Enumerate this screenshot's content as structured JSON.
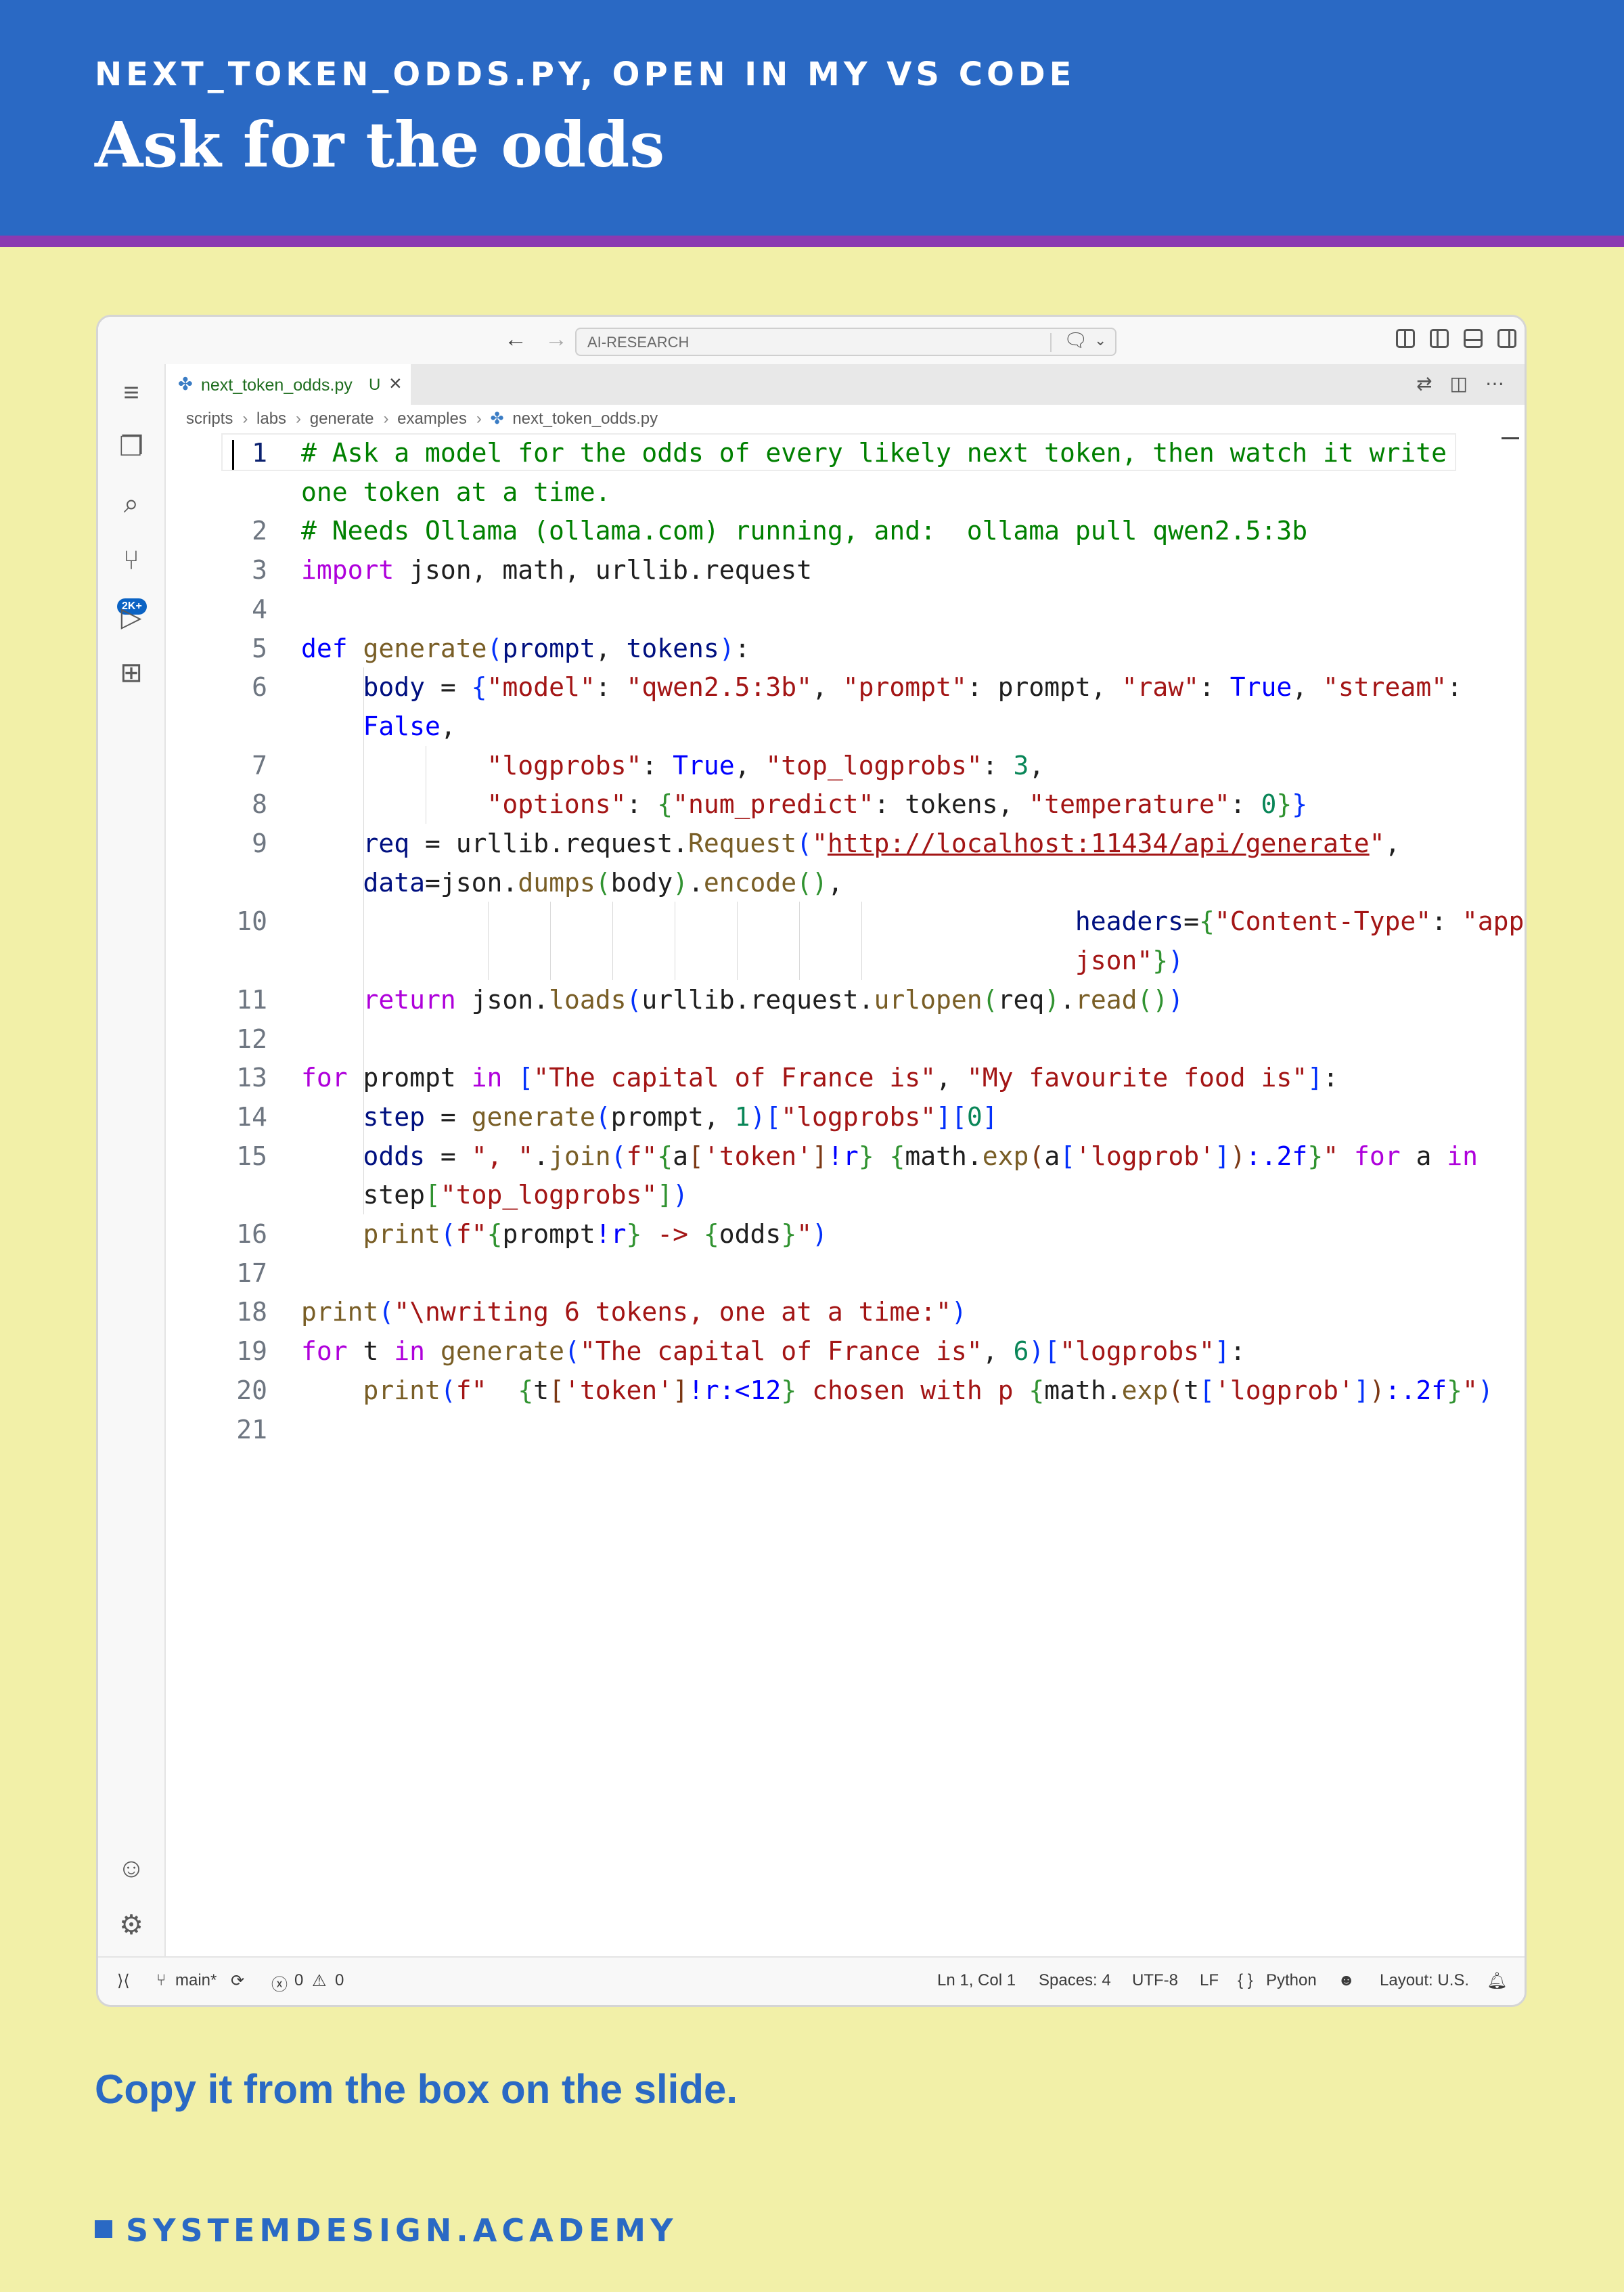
{
  "slide": {
    "kicker": "NEXT_TOKEN_ODDS.PY, OPEN IN MY VS CODE",
    "title": "Ask for the odds",
    "caption": "Copy it from the box on the slide.",
    "brand": "SYSTEMDESIGN.ACADEMY"
  },
  "titlebar": {
    "command_center": "AI-RESEARCH"
  },
  "activity_bar": {
    "scm_badge": "2K+"
  },
  "tab": {
    "filename": "next_token_odds.py",
    "status": "U"
  },
  "breadcrumbs": [
    "scripts",
    "labs",
    "generate",
    "examples",
    "next_token_odds.py"
  ],
  "editor": {
    "line_numbers": [
      "1",
      "2",
      "3",
      "4",
      "5",
      "6",
      "7",
      "8",
      "9",
      "10",
      "11",
      "12",
      "13",
      "14",
      "15",
      "16",
      "17",
      "18",
      "19",
      "20",
      "21"
    ]
  },
  "statusbar": {
    "branch": "main*",
    "errors": "0",
    "warnings": "0",
    "position": "Ln 1, Col 1",
    "spaces": "Spaces: 4",
    "encoding": "UTF-8",
    "eol": "LF",
    "language": "Python",
    "layout": "Layout: U.S."
  },
  "code_lines": [
    [
      [
        "c-com",
        "# Ask a model for the odds of every likely next token, then watch it write"
      ]
    ],
    [
      [
        "c-com",
        "one token at a time."
      ]
    ],
    [
      [
        "c-com",
        "# Needs Ollama (ollama.com) running, and:  ollama pull qwen2.5:3b"
      ]
    ],
    [
      [
        "c-kw",
        "import"
      ],
      [
        "c-id",
        " json, math, urllib.request"
      ]
    ],
    [],
    [
      [
        "c-def",
        "def"
      ],
      [
        "c-id",
        " "
      ],
      [
        "c-fn",
        "generate"
      ],
      [
        "c-b1",
        "("
      ],
      [
        "c-var",
        "prompt"
      ],
      [
        "c-id",
        ", "
      ],
      [
        "c-var",
        "tokens"
      ],
      [
        "c-b1",
        ")"
      ],
      [
        "c-id",
        ":"
      ]
    ],
    [
      [
        "c-id",
        "    "
      ],
      [
        "c-var",
        "body"
      ],
      [
        "c-id",
        " = "
      ],
      [
        "c-b1",
        "{"
      ],
      [
        "c-str",
        "\"model\""
      ],
      [
        "c-id",
        ": "
      ],
      [
        "c-str",
        "\"qwen2.5:3b\""
      ],
      [
        "c-id",
        ", "
      ],
      [
        "c-str",
        "\"prompt\""
      ],
      [
        "c-id",
        ": prompt, "
      ],
      [
        "c-str",
        "\"raw\""
      ],
      [
        "c-id",
        ": "
      ],
      [
        "c-def",
        "True"
      ],
      [
        "c-id",
        ", "
      ],
      [
        "c-str",
        "\"stream\""
      ],
      [
        "c-id",
        ":"
      ]
    ],
    [
      [
        "c-id",
        "    "
      ],
      [
        "c-def",
        "False"
      ],
      [
        "c-id",
        ","
      ]
    ],
    [
      [
        "c-id",
        "            "
      ],
      [
        "c-str",
        "\"logprobs\""
      ],
      [
        "c-id",
        ": "
      ],
      [
        "c-def",
        "True"
      ],
      [
        "c-id",
        ", "
      ],
      [
        "c-str",
        "\"top_logprobs\""
      ],
      [
        "c-id",
        ": "
      ],
      [
        "c-num",
        "3"
      ],
      [
        "c-id",
        ","
      ]
    ],
    [
      [
        "c-id",
        "            "
      ],
      [
        "c-str",
        "\"options\""
      ],
      [
        "c-id",
        ": "
      ],
      [
        "c-b2",
        "{"
      ],
      [
        "c-str",
        "\"num_predict\""
      ],
      [
        "c-id",
        ": tokens, "
      ],
      [
        "c-str",
        "\"temperature\""
      ],
      [
        "c-id",
        ": "
      ],
      [
        "c-num",
        "0"
      ],
      [
        "c-b2",
        "}"
      ],
      [
        "c-b1",
        "}"
      ]
    ],
    [
      [
        "c-id",
        "    "
      ],
      [
        "c-var",
        "req"
      ],
      [
        "c-id",
        " = urllib.request."
      ],
      [
        "c-fn",
        "Request"
      ],
      [
        "c-b1",
        "("
      ],
      [
        "c-str",
        "\""
      ],
      [
        "c-url",
        "http://localhost:11434/api/generate"
      ],
      [
        "c-str",
        "\""
      ],
      [
        "c-id",
        ","
      ]
    ],
    [
      [
        "c-id",
        "    "
      ],
      [
        "c-var",
        "data"
      ],
      [
        "c-id",
        "=json."
      ],
      [
        "c-fn",
        "dumps"
      ],
      [
        "c-b2",
        "("
      ],
      [
        "c-id",
        "body"
      ],
      [
        "c-b2",
        ")"
      ],
      [
        "c-id",
        "."
      ],
      [
        "c-fn",
        "encode"
      ],
      [
        "c-b2",
        "()"
      ],
      [
        "c-id",
        ","
      ]
    ],
    [
      [
        "c-id",
        "                                                  "
      ],
      [
        "c-var",
        "headers"
      ],
      [
        "c-id",
        "="
      ],
      [
        "c-b2",
        "{"
      ],
      [
        "c-str",
        "\"Content-Type\""
      ],
      [
        "c-id",
        ": "
      ],
      [
        "c-str",
        "\"application/"
      ]
    ],
    [
      [
        "c-id",
        "                                                  "
      ],
      [
        "c-str",
        "json\""
      ],
      [
        "c-b2",
        "}"
      ],
      [
        "c-b1",
        ")"
      ]
    ],
    [
      [
        "c-id",
        "    "
      ],
      [
        "c-kw",
        "return"
      ],
      [
        "c-id",
        " json."
      ],
      [
        "c-fn",
        "loads"
      ],
      [
        "c-b1",
        "("
      ],
      [
        "c-id",
        "urllib.request."
      ],
      [
        "c-fn",
        "urlopen"
      ],
      [
        "c-b2",
        "("
      ],
      [
        "c-id",
        "req"
      ],
      [
        "c-b2",
        ")"
      ],
      [
        "c-id",
        "."
      ],
      [
        "c-fn",
        "read"
      ],
      [
        "c-b2",
        "()"
      ],
      [
        "c-b1",
        ")"
      ]
    ],
    [],
    [
      [
        "c-kw",
        "for"
      ],
      [
        "c-id",
        " prompt "
      ],
      [
        "c-kw",
        "in"
      ],
      [
        "c-id",
        " "
      ],
      [
        "c-b1",
        "["
      ],
      [
        "c-str",
        "\"The capital of France is\""
      ],
      [
        "c-id",
        ", "
      ],
      [
        "c-str",
        "\"My favourite food is\""
      ],
      [
        "c-b1",
        "]"
      ],
      [
        "c-id",
        ":"
      ]
    ],
    [
      [
        "c-id",
        "    "
      ],
      [
        "c-var",
        "step"
      ],
      [
        "c-id",
        " = "
      ],
      [
        "c-fn",
        "generate"
      ],
      [
        "c-b1",
        "("
      ],
      [
        "c-id",
        "prompt, "
      ],
      [
        "c-num",
        "1"
      ],
      [
        "c-b1",
        ")"
      ],
      [
        "c-b1",
        "["
      ],
      [
        "c-str",
        "\"logprobs\""
      ],
      [
        "c-b1",
        "]"
      ],
      [
        "c-b1",
        "["
      ],
      [
        "c-num",
        "0"
      ],
      [
        "c-b1",
        "]"
      ]
    ],
    [
      [
        "c-id",
        "    "
      ],
      [
        "c-var",
        "odds"
      ],
      [
        "c-id",
        " = "
      ],
      [
        "c-str",
        "\", \""
      ],
      [
        "c-id",
        "."
      ],
      [
        "c-fn",
        "join"
      ],
      [
        "c-b1",
        "("
      ],
      [
        "c-str",
        "f\""
      ],
      [
        "c-b2",
        "{"
      ],
      [
        "c-id",
        "a"
      ],
      [
        "c-b3",
        "["
      ],
      [
        "c-str",
        "'token'"
      ],
      [
        "c-b3",
        "]"
      ],
      [
        "c-def",
        "!r"
      ],
      [
        "c-b2",
        "}"
      ],
      [
        "c-str",
        " "
      ],
      [
        "c-b2",
        "{"
      ],
      [
        "c-id",
        "math."
      ],
      [
        "c-fn",
        "exp"
      ],
      [
        "c-b3",
        "("
      ],
      [
        "c-id",
        "a"
      ],
      [
        "c-b1",
        "["
      ],
      [
        "c-str",
        "'logprob'"
      ],
      [
        "c-b1",
        "]"
      ],
      [
        "c-b3",
        ")"
      ],
      [
        "c-def",
        ":.2f"
      ],
      [
        "c-b2",
        "}"
      ],
      [
        "c-str",
        "\""
      ],
      [
        "c-id",
        " "
      ],
      [
        "c-kw",
        "for"
      ],
      [
        "c-id",
        " a "
      ],
      [
        "c-kw",
        "in"
      ]
    ],
    [
      [
        "c-id",
        "    step"
      ],
      [
        "c-b2",
        "["
      ],
      [
        "c-str",
        "\"top_logprobs\""
      ],
      [
        "c-b2",
        "]"
      ],
      [
        "c-b1",
        ")"
      ]
    ],
    [
      [
        "c-id",
        "    "
      ],
      [
        "c-fn",
        "print"
      ],
      [
        "c-b1",
        "("
      ],
      [
        "c-str",
        "f\""
      ],
      [
        "c-b2",
        "{"
      ],
      [
        "c-id",
        "prompt"
      ],
      [
        "c-def",
        "!r"
      ],
      [
        "c-b2",
        "}"
      ],
      [
        "c-str",
        " -> "
      ],
      [
        "c-b2",
        "{"
      ],
      [
        "c-id",
        "odds"
      ],
      [
        "c-b2",
        "}"
      ],
      [
        "c-str",
        "\""
      ],
      [
        "c-b1",
        ")"
      ]
    ],
    [],
    [
      [
        "c-fn",
        "print"
      ],
      [
        "c-b1",
        "("
      ],
      [
        "c-str",
        "\"\\nwriting 6 tokens, one at a time:\""
      ],
      [
        "c-b1",
        ")"
      ]
    ],
    [
      [
        "c-kw",
        "for"
      ],
      [
        "c-id",
        " t "
      ],
      [
        "c-kw",
        "in"
      ],
      [
        "c-id",
        " "
      ],
      [
        "c-fn",
        "generate"
      ],
      [
        "c-b1",
        "("
      ],
      [
        "c-str",
        "\"The capital of France is\""
      ],
      [
        "c-id",
        ", "
      ],
      [
        "c-num",
        "6"
      ],
      [
        "c-b1",
        ")"
      ],
      [
        "c-b1",
        "["
      ],
      [
        "c-str",
        "\"logprobs\""
      ],
      [
        "c-b1",
        "]"
      ],
      [
        "c-id",
        ":"
      ]
    ],
    [
      [
        "c-id",
        "    "
      ],
      [
        "c-fn",
        "print"
      ],
      [
        "c-b1",
        "("
      ],
      [
        "c-str",
        "f\"  "
      ],
      [
        "c-b2",
        "{"
      ],
      [
        "c-id",
        "t"
      ],
      [
        "c-b3",
        "["
      ],
      [
        "c-str",
        "'token'"
      ],
      [
        "c-b3",
        "]"
      ],
      [
        "c-def",
        "!r:<12"
      ],
      [
        "c-b2",
        "}"
      ],
      [
        "c-str",
        " chosen with p "
      ],
      [
        "c-b2",
        "{"
      ],
      [
        "c-id",
        "math."
      ],
      [
        "c-fn",
        "exp"
      ],
      [
        "c-b3",
        "("
      ],
      [
        "c-id",
        "t"
      ],
      [
        "c-b1",
        "["
      ],
      [
        "c-str",
        "'logprob'"
      ],
      [
        "c-b1",
        "]"
      ],
      [
        "c-b3",
        ")"
      ],
      [
        "c-def",
        ":.2f"
      ],
      [
        "c-b2",
        "}"
      ],
      [
        "c-str",
        "\""
      ],
      [
        "c-b1",
        ")"
      ]
    ],
    []
  ]
}
